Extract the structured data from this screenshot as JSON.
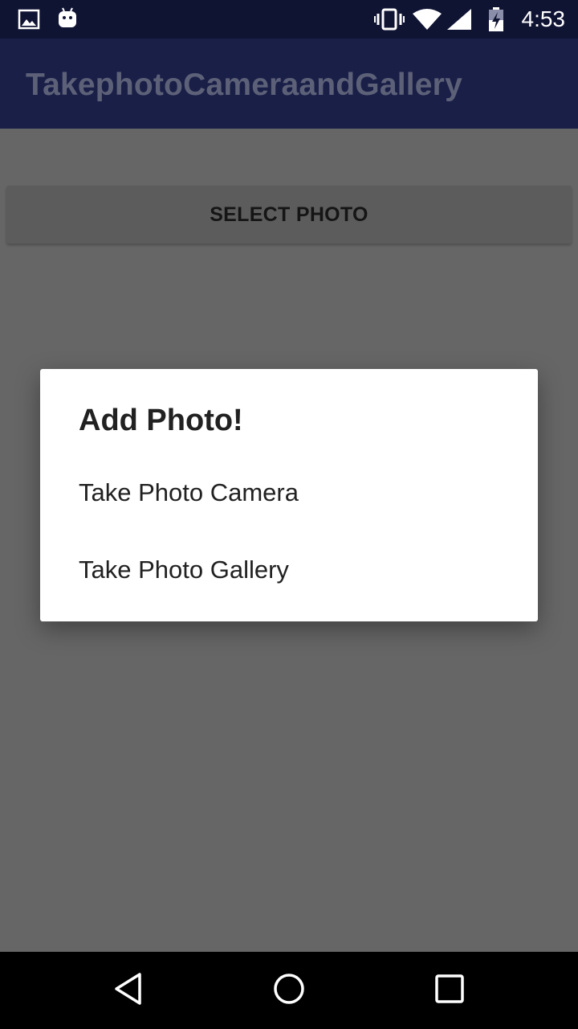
{
  "status_bar": {
    "time": "4:53",
    "left_icons": [
      "image-icon",
      "android-icon"
    ],
    "right_icons": [
      "vibrate-icon",
      "wifi-icon",
      "cell-signal-icon",
      "battery-charging-icon"
    ]
  },
  "app_bar": {
    "title": "TakephotoCameraandGallery"
  },
  "main": {
    "select_button_label": "SELECT PHOTO"
  },
  "dialog": {
    "title": "Add Photo!",
    "items": [
      {
        "label": "Take Photo Camera"
      },
      {
        "label": "Take Photo Gallery"
      }
    ]
  },
  "nav_bar": {
    "icons": [
      "back-icon",
      "home-icon",
      "recents-icon"
    ]
  },
  "colors": {
    "status_bar": "#101433",
    "app_bar": "#1a1f48",
    "scrim_background": "#666666",
    "dialog_background": "#ffffff",
    "nav_bar": "#000000"
  }
}
